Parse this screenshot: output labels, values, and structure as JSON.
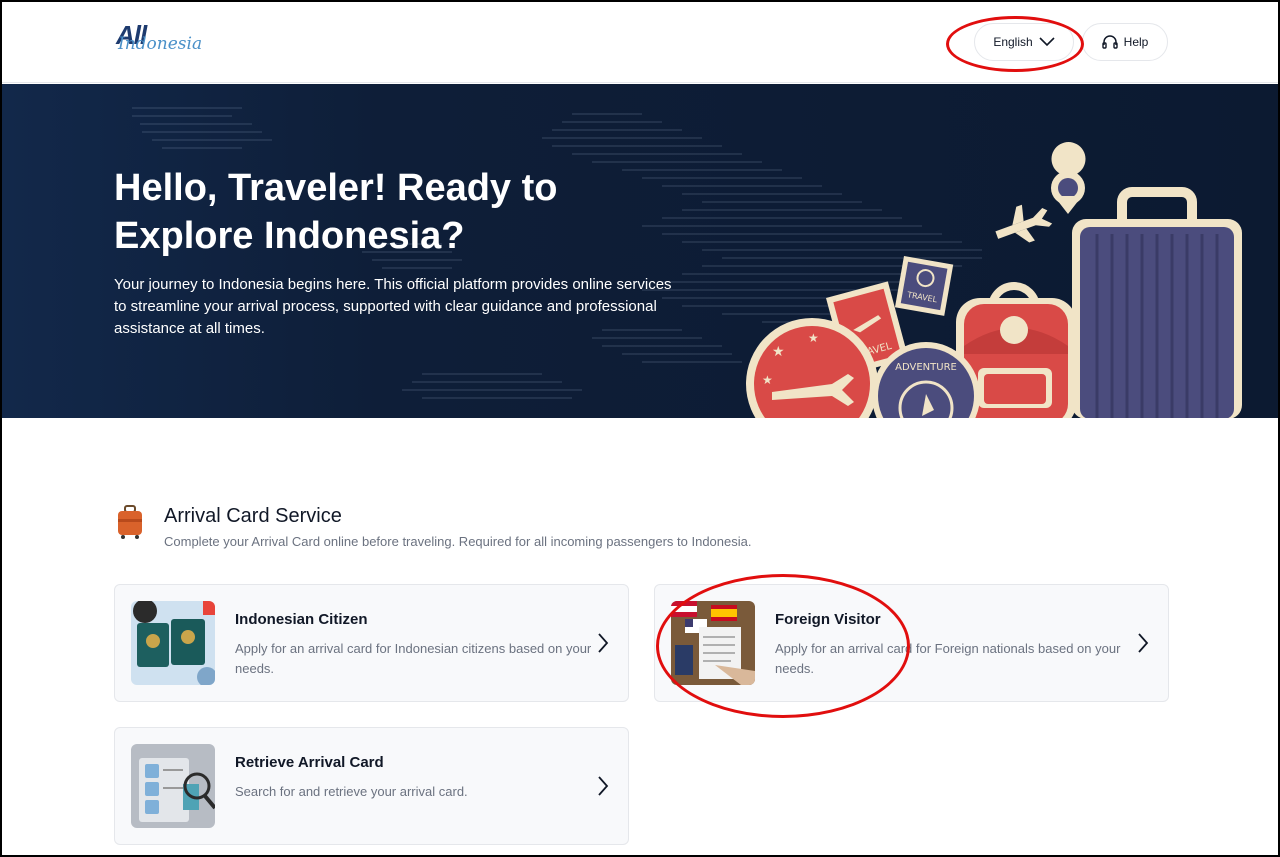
{
  "header": {
    "logo_main": "All",
    "logo_sub": "Indonesia",
    "language_label": "English",
    "help_label": "Help"
  },
  "hero": {
    "title": "Hello, Traveler! Ready to Explore Indonesia?",
    "description": "Your journey to Indonesia begins here. This official platform provides online services to streamline your arrival process, supported with clear guidance and professional assistance at all times.",
    "stamp_travel_1": "TRAVEL",
    "stamp_travel_2": "TRAVEL",
    "stamp_adventure": "ADVENTURE"
  },
  "section": {
    "title": "Arrival Card Service",
    "subtitle": "Complete your Arrival Card online before traveling. Required for all incoming passengers to Indonesia."
  },
  "cards": [
    {
      "title": "Indonesian Citizen",
      "description": "Apply for an arrival card for Indonesian citizens based on your needs."
    },
    {
      "title": "Foreign Visitor",
      "description": "Apply for an arrival card for Foreign nationals based on your needs."
    },
    {
      "title": "Retrieve Arrival Card",
      "description": "Search for and retrieve your arrival card."
    }
  ],
  "colors": {
    "annotation_red": "#e10e0e",
    "hero_bg": "#0c1a31",
    "brand_navy": "#1d3a6e",
    "illus_red": "#d94a47",
    "illus_cream": "#f1e4c7",
    "illus_purple": "#4b4c7d"
  },
  "icons": [
    "chevron-down-icon",
    "headset-icon",
    "suitcase-icon",
    "chevron-right-icon"
  ]
}
